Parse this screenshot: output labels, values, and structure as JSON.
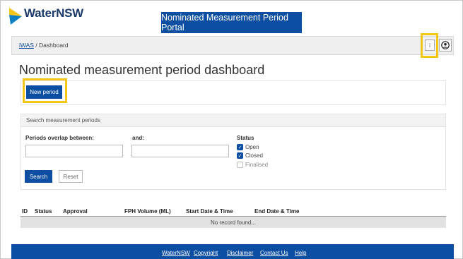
{
  "brand": {
    "logo_text": "WaterNSW",
    "banner": "Nominated Measurement Period Portal"
  },
  "breadcrumb": {
    "root": "iWAS",
    "separator": " / ",
    "current": "Dashboard"
  },
  "toolbar": {
    "info_label": "i"
  },
  "page": {
    "title": "Nominated measurement period dashboard",
    "new_button": "New period"
  },
  "search": {
    "heading": "Search measurement periods",
    "overlap_label": "Periods overlap between:",
    "and_label": "and:",
    "from_value": "",
    "to_value": "",
    "status_label": "Status",
    "status_options": [
      {
        "label": "Open",
        "checked": true
      },
      {
        "label": "Closed",
        "checked": true
      },
      {
        "label": "Finalised",
        "checked": false
      }
    ],
    "search_button": "Search",
    "reset_button": "Reset"
  },
  "table": {
    "columns": [
      "ID",
      "Status",
      "Approval",
      "FPH Volume (ML)",
      "Start Date & Time",
      "End Date & Time"
    ],
    "empty_text": "No record found..."
  },
  "footer": {
    "links": [
      "WaterNSW",
      "Copyright",
      "Disclaimer",
      "Contact Us",
      "Help"
    ]
  },
  "colors": {
    "primary": "#0b4ea2",
    "highlight": "#f5c518"
  }
}
